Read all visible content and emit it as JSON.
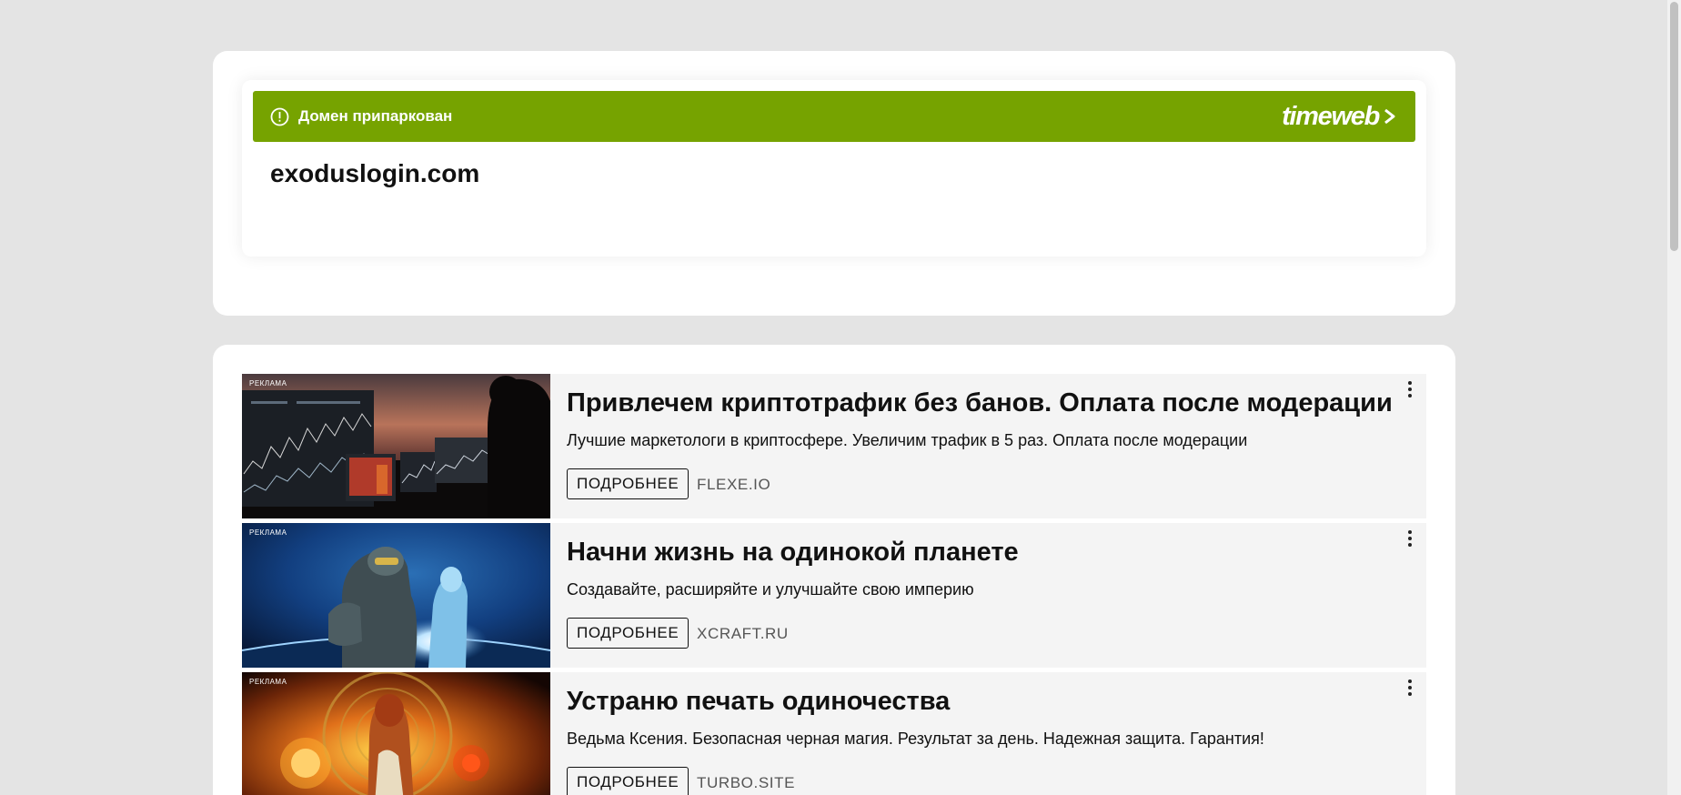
{
  "banner": {
    "text": "Домен припаркован",
    "brand": "timeweb",
    "icon": "alert-circle-icon",
    "color": "#76a300"
  },
  "domain": "exoduslogin.com",
  "ads": [
    {
      "badge": "РЕКЛАМА",
      "title": "Привлечем криптотрафик без банов. Оплата после модерации",
      "description": "Лучшие маркетологи в криптосфере. Увеличим трафик в 5 раз. Оплата после модерации",
      "button": "ПОДРОБНЕЕ",
      "site": "FLEXE.IO",
      "image": "trading-monitors-image"
    },
    {
      "badge": "РЕКЛАМА",
      "title": "Начни жизнь на одинокой планете",
      "description": "Создавайте, расширяйте и улучшайте свою империю",
      "button": "ПОДРОБНЕЕ",
      "site": "XCRAFT.RU",
      "image": "space-soldier-image"
    },
    {
      "badge": "РЕКЛАМА",
      "title": "Устраню печать одиночества",
      "description": "Ведьма Ксения. Безопасная черная магия. Результат за день. Надежная защита. Гарантия!",
      "button": "ПОДРОБНЕЕ",
      "site": "TURBO.SITE",
      "image": "witch-fire-image"
    }
  ]
}
